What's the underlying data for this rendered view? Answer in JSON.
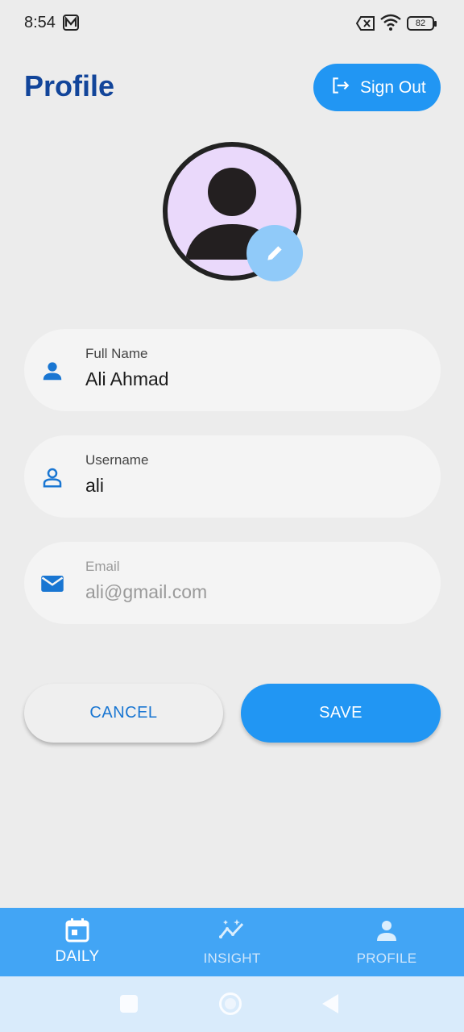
{
  "status_bar": {
    "time": "8:54",
    "battery": "82"
  },
  "header": {
    "title": "Profile",
    "signout_label": "Sign Out"
  },
  "form": {
    "full_name": {
      "label": "Full Name",
      "value": "Ali Ahmad",
      "icon": "person-icon"
    },
    "username": {
      "label": "Username",
      "value": "ali",
      "icon": "person-outline-icon"
    },
    "email": {
      "label": "Email",
      "value": "ali@gmail.com",
      "icon": "mail-icon",
      "disabled": true
    }
  },
  "actions": {
    "cancel_label": "CANCEL",
    "save_label": "SAVE"
  },
  "bottom_nav": {
    "items": [
      {
        "label": "DAILY",
        "icon": "calendar-icon",
        "active": true
      },
      {
        "label": "INSIGHT",
        "icon": "insight-icon",
        "active": false
      },
      {
        "label": "PROFILE",
        "icon": "person-icon",
        "active": false
      }
    ]
  },
  "colors": {
    "primary": "#2196f3",
    "title": "#12459a",
    "nav_bg": "#42a5f5"
  }
}
